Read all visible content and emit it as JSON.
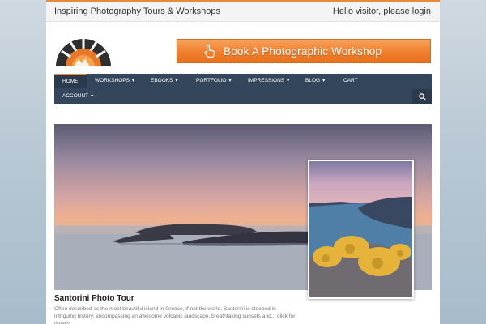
{
  "topbar": {
    "tagline": "Inspiring Photography Tours & Workshops",
    "login_text": "Hello visitor, please login"
  },
  "header": {
    "banner_label": "Book A Photographic Workshop"
  },
  "nav": {
    "items": [
      {
        "label": "HOME",
        "active": true
      },
      {
        "label": "WORKSHOPS",
        "dropdown": true
      },
      {
        "label": "EBOOKS",
        "dropdown": true
      },
      {
        "label": "PORTFOLIO",
        "dropdown": true
      },
      {
        "label": "IMPRESSIONS",
        "dropdown": true
      },
      {
        "label": "BLOG",
        "dropdown": true
      },
      {
        "label": "CART"
      },
      {
        "label": "ACCOUNT",
        "dropdown": true
      }
    ],
    "search_icon": "search-icon"
  },
  "feature": {
    "title": "Santorini Photo Tour",
    "description": "Often described as the most beautiful island in Greece, if not the world, Santorini is steeped in intriguing history, encompassing an awesome volcanic landscape, breathtaking sunsets and...",
    "more_link": "click for details"
  },
  "colors": {
    "accent": "#e8893a",
    "nav_bg": "#34465c",
    "banner": "#ef7f2e"
  }
}
